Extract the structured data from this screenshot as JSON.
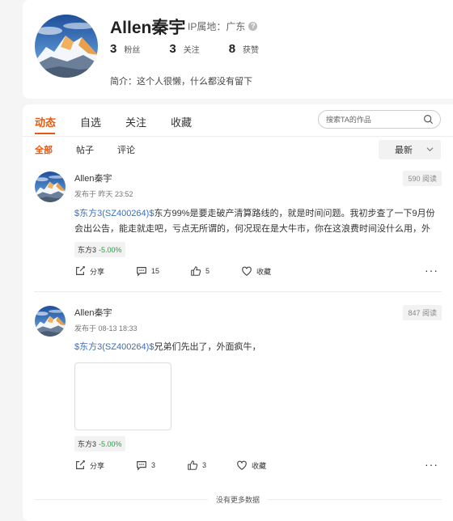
{
  "profile": {
    "name": "Allen秦宇",
    "ip_label": "IP属地：广东",
    "stats": [
      {
        "num": "3",
        "label": "粉丝"
      },
      {
        "num": "3",
        "label": "关注"
      },
      {
        "num": "8",
        "label": "获赞"
      }
    ],
    "bio": "简介：这个人很懒，什么都没有留下"
  },
  "tabs": [
    "动态",
    "自选",
    "关注",
    "收藏"
  ],
  "search": {
    "placeholder": "搜索TA的作品",
    "icon": "search-icon"
  },
  "subtabs": [
    "全部",
    "帖子",
    "评论"
  ],
  "sort": {
    "label": "最新"
  },
  "posts": [
    {
      "author": "Allen秦宇",
      "time": "发布于 昨天 23:52",
      "views": "590 阅读",
      "stock_link": "$东方3(SZ400264)$",
      "text": "东方99%是要走破产清算路线的，就是时间问题。我初步查了一下9月份会出公告，能走就走吧，亏点无所谓的，何况现在是大牛市，你在这浪费时间没什么用，外面...",
      "tag_name": "东方3",
      "tag_change": "-5.00%",
      "share": "分享",
      "comments": "15",
      "likes": "5",
      "fav": "收藏"
    },
    {
      "author": "Allen秦宇",
      "time": "发布于 08-13 18:33",
      "views": "847 阅读",
      "stock_link": "$东方3(SZ400264)$",
      "text": "兄弟们先出了，外面疯牛，",
      "tag_name": "东方3",
      "tag_change": "-5.00%",
      "share": "分享",
      "comments": "3",
      "likes": "3",
      "fav": "收藏"
    }
  ],
  "end_text": "没有更多数据",
  "colors": {
    "accent": "#e8590c",
    "link": "#3a6fb8",
    "change": "#2a9d46"
  }
}
